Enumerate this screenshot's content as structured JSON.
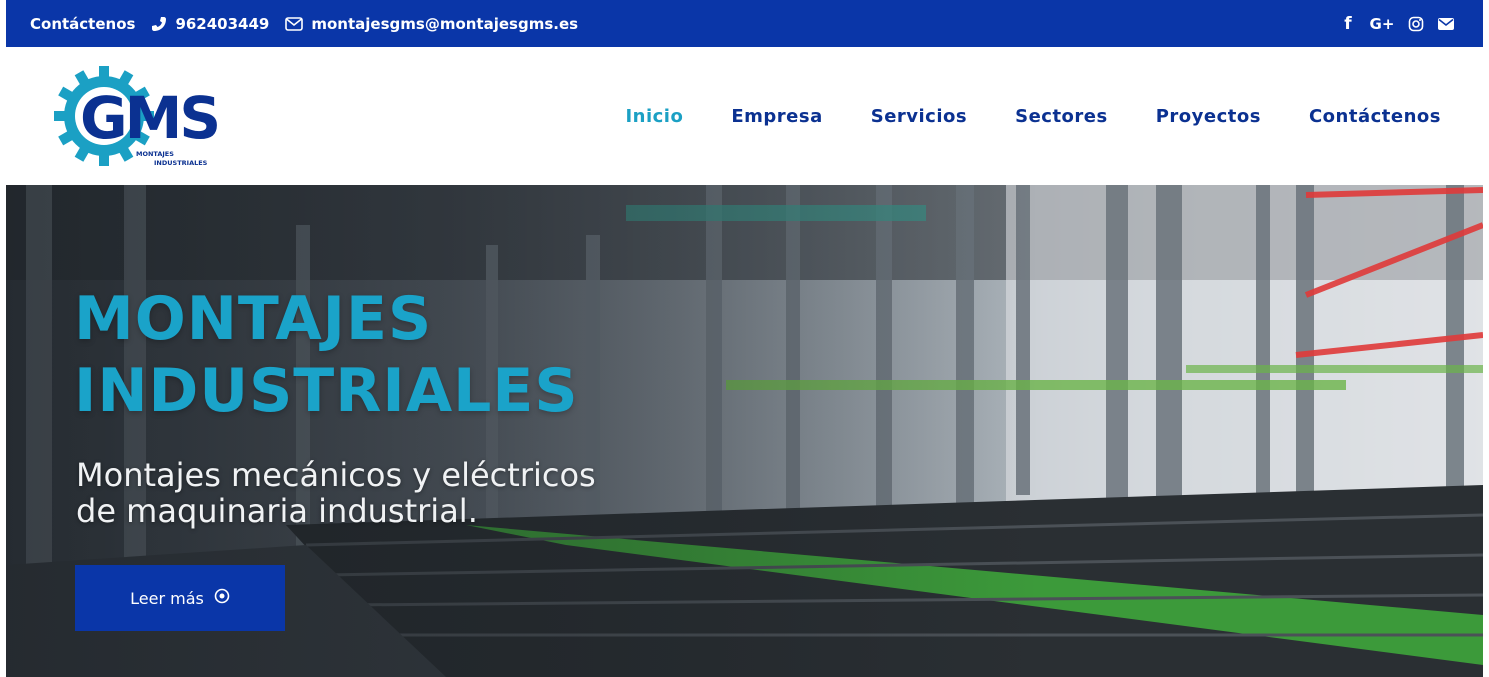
{
  "topbar": {
    "contact_label": "Contáctenos",
    "phone": "962403449",
    "email": "montajesgms@montajesgms.es",
    "social_icons": [
      "facebook-icon",
      "google-plus-icon",
      "instagram-icon",
      "mail-icon"
    ],
    "google_plus_label": "G+",
    "facebook_label": "f"
  },
  "logo": {
    "brand": "GMS",
    "tagline_line1": "MONTAJES",
    "tagline_line2": "INDUSTRIALES"
  },
  "nav": {
    "items": [
      {
        "label": "Inicio",
        "active": true
      },
      {
        "label": "Empresa",
        "active": false
      },
      {
        "label": "Servicios",
        "active": false
      },
      {
        "label": "Sectores",
        "active": false
      },
      {
        "label": "Proyectos",
        "active": false
      },
      {
        "label": "Contáctenos",
        "active": false
      }
    ]
  },
  "hero": {
    "title_line1": "MONTAJES",
    "title_line2": "INDUSTRIALES",
    "subtitle_line1": "Montajes mecánicos y eléctricos",
    "subtitle_line2": "de maquinaria industrial.",
    "button_label": "Leer más"
  },
  "colors": {
    "brand_blue": "#0a36a8",
    "accent_cyan": "#1ba0c4",
    "nav_text": "#0b3191"
  }
}
